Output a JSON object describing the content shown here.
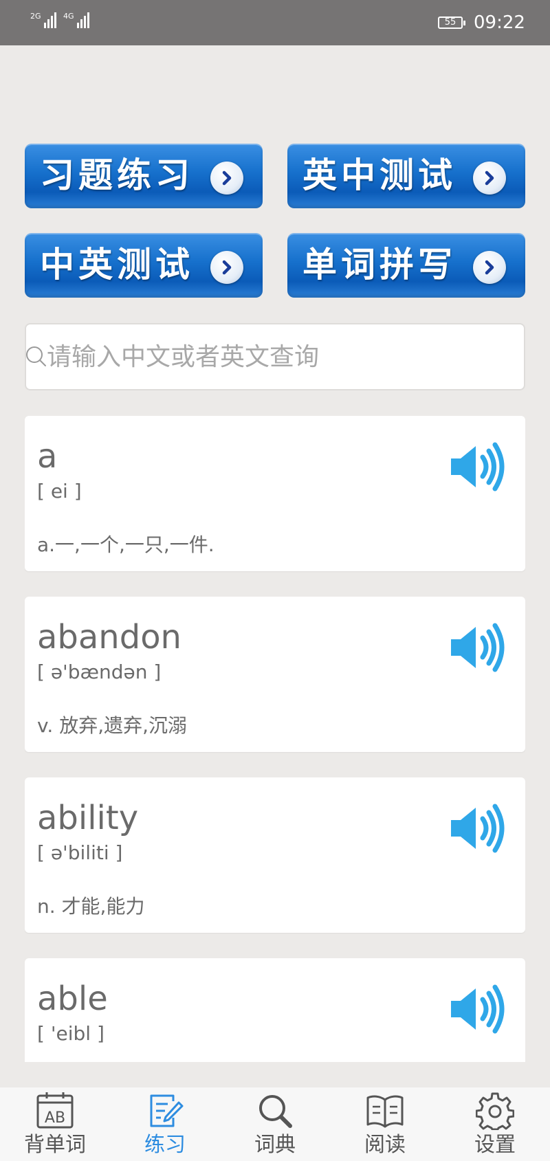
{
  "status_bar": {
    "signal1_label": "2G",
    "signal2_label": "4G",
    "battery": "55",
    "time": "09:22"
  },
  "practice": {
    "buttons": [
      {
        "label": "习题练习",
        "icon": "chevron-right-icon"
      },
      {
        "label": "英中测试",
        "icon": "chevron-right-icon"
      },
      {
        "label": "中英测试",
        "icon": "chevron-right-icon"
      },
      {
        "label": "单词拼写",
        "icon": "chevron-right-icon"
      }
    ]
  },
  "search": {
    "placeholder": "请输入中文或者英文查询",
    "value": "",
    "icon": "search-icon"
  },
  "words": [
    {
      "word": "a",
      "phonetic": "[ ei ]",
      "definition": "a.一,一个,一只,一件."
    },
    {
      "word": "abandon",
      "phonetic": "[ ə'bændən ]",
      "definition": "v. 放弃,遗弃,沉溺"
    },
    {
      "word": "ability",
      "phonetic": "[ ə'biliti ]",
      "definition": "n. 才能,能力"
    },
    {
      "word": "able",
      "phonetic": "[ 'eibl ]",
      "definition": ""
    }
  ],
  "nav": {
    "items": [
      {
        "label": "背单词",
        "icon": "flashcard-ab-icon"
      },
      {
        "label": "练习",
        "icon": "edit-note-icon"
      },
      {
        "label": "词典",
        "icon": "search-icon"
      },
      {
        "label": "阅读",
        "icon": "book-icon"
      },
      {
        "label": "设置",
        "icon": "gear-icon"
      }
    ],
    "active_index": 1
  },
  "colors": {
    "accent": "#2D8CE0",
    "button_blue": "#1670CC",
    "speaker_blue": "#2FA7E8",
    "status_bar": "#767474",
    "background": "#ECEAE8"
  }
}
